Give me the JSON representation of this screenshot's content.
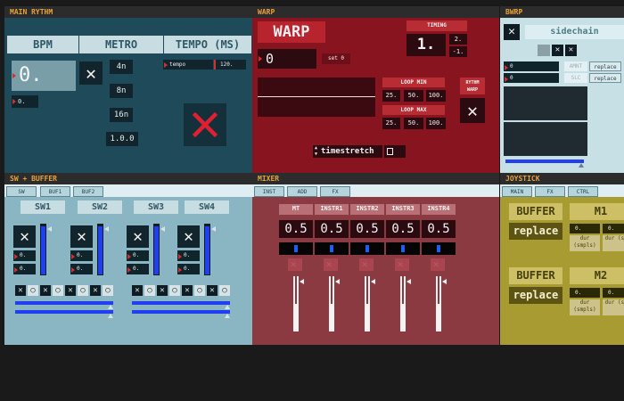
{
  "colors": {
    "accent": "#e8a33c",
    "main_rythm_bg": "#1f4a5a",
    "warp_bg": "#87141f",
    "bwrp_bg": "#c6e0e6",
    "sw_buffer_bg": "#8ab6c3",
    "mixer_bg": "#8b3a42",
    "joystick_bg": "#a89b31",
    "slider_blue": "#1f3ff0",
    "x_red": "#e02030"
  },
  "main_rythm": {
    "title": "MAIN RYTHM",
    "headers": [
      "BPM",
      "METRO",
      "TEMPO (MS)"
    ],
    "bpm_value": "0.",
    "bpm_small": "0.",
    "metro_options": [
      "4n",
      "8n",
      "16n",
      "1.0.0"
    ],
    "tempo_label": "tempo",
    "tempo_value": "120.",
    "close_icon": "close-icon",
    "big_x_icon": "red-x-icon"
  },
  "warp": {
    "title": "WARP",
    "name": "WARP",
    "timing_label": "TIMING",
    "timing_value": "1.",
    "timing_small": [
      "2.",
      "-1."
    ],
    "value": "0",
    "set_label": "set 0",
    "loop_min_label": "LOOP MIN",
    "loop_min_values": [
      "25.",
      "50.",
      "100."
    ],
    "loop_max_label": "LOOP MAX",
    "loop_max_values": [
      "25.",
      "50.",
      "100."
    ],
    "rythm_warp_label": "RYTHM WARP",
    "mode_value": "timestretch"
  },
  "bwrp": {
    "title": "BWRP",
    "sidechain_label": "sidechain",
    "rows": [
      {
        "value": "0",
        "tag": "AMNT",
        "btn": "replace"
      },
      {
        "value": "0",
        "tag": "SLC",
        "btn": "replace"
      }
    ]
  },
  "sw_buffer": {
    "title": "SW + BUFFER",
    "tabs": [
      "SW",
      "BUF1",
      "BUF2"
    ],
    "columns": [
      "SW1",
      "SW2",
      "SW3",
      "SW4"
    ],
    "num_value": "0.",
    "toggle_pattern": [
      "x",
      "o",
      "x",
      "o",
      "x",
      "o",
      "x",
      "o"
    ]
  },
  "mixer": {
    "title": "MIXER",
    "tabs": [
      "INST",
      "ADD",
      "FX"
    ],
    "channels": [
      {
        "name": "MT",
        "value": "0.5",
        "level": 0.5
      },
      {
        "name": "INSTR1",
        "value": "0.5",
        "level": 0.5
      },
      {
        "name": "INSTR2",
        "value": "0.5",
        "level": 0.5
      },
      {
        "name": "INSTR3",
        "value": "0.5",
        "level": 0.5
      },
      {
        "name": "INSTR4",
        "value": "0.5",
        "level": 0.5
      }
    ]
  },
  "joystick": {
    "title": "JOYSTICK",
    "tabs": [
      "MAIN",
      "FX",
      "CTRL"
    ],
    "rows": [
      {
        "buffer_label": "BUFFER",
        "replace_label": "replace",
        "m_label": "M1",
        "num_a": "0.",
        "num_b": "0.",
        "sub_a": "dur (smpls)",
        "sub_b": "dur (sec"
      },
      {
        "buffer_label": "BUFFER",
        "replace_label": "replace",
        "m_label": "M2",
        "num_a": "0.",
        "num_b": "0.",
        "sub_a": "dur (smpls)",
        "sub_b": "dur (sec"
      }
    ]
  }
}
